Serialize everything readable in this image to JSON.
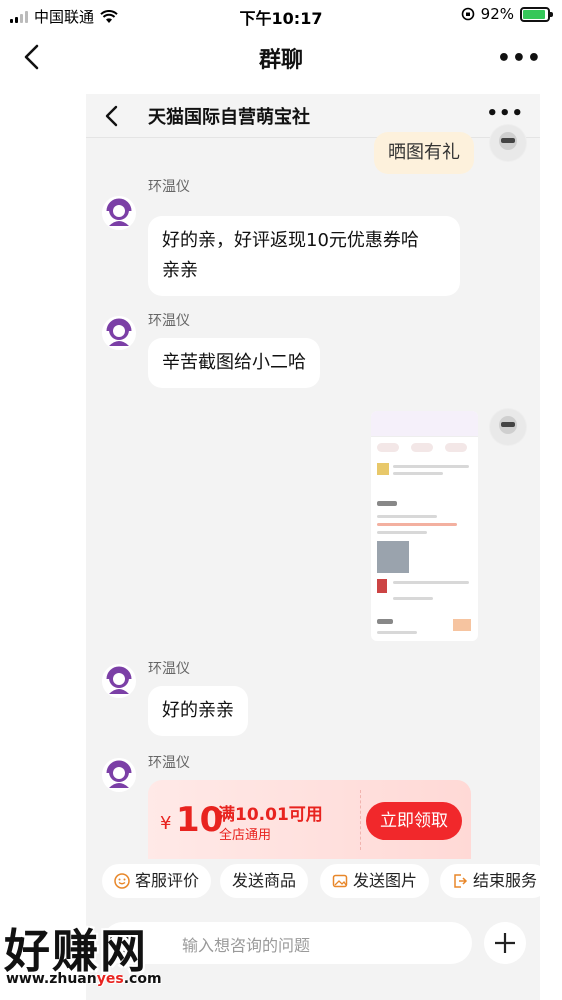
{
  "status_bar": {
    "carrier": "中国联通",
    "time": "下午10:17",
    "battery": "92%",
    "battery_level": 0.92
  },
  "outer_nav": {
    "title": "群聊",
    "more": "•••"
  },
  "inner_header": {
    "shop_name": "天猫国际自营萌宝社",
    "more": "•••"
  },
  "messages": [
    {
      "side": "right",
      "type": "text",
      "text": "晒图有礼"
    },
    {
      "side": "left",
      "type": "text",
      "sender": "环温仪",
      "lines": [
        "好的亲，好评返现10元优惠券哈",
        "亲亲"
      ]
    },
    {
      "side": "left",
      "type": "text",
      "sender": "环温仪",
      "text": "辛苦截图给小二哈"
    },
    {
      "side": "right",
      "type": "image"
    },
    {
      "side": "left",
      "type": "text",
      "sender": "环温仪",
      "text": "好的亲亲"
    },
    {
      "side": "left",
      "type": "coupon",
      "sender": "环温仪"
    }
  ],
  "coupon": {
    "currency": "¥",
    "amount": "10",
    "condition": "满10.01可用",
    "scope": "全店通用",
    "claim_label": "立即领取"
  },
  "quick_actions": [
    {
      "label": "客服评价",
      "icon": "smile-icon"
    },
    {
      "label": "发送商品",
      "icon": ""
    },
    {
      "label": "发送图片",
      "icon": "image-icon"
    },
    {
      "label": "结束服务",
      "icon": "exit-icon"
    }
  ],
  "input": {
    "placeholder": "输入想咨询的问题"
  },
  "watermark": {
    "text": "好赚网",
    "url_prefix": "www.zhuan",
    "url_highlight": "yes",
    "url_suffix": ".com"
  },
  "colors": {
    "accent": "#f1282b",
    "coupon_text": "#e8231f",
    "bubble_highlight": "#fdf1dc",
    "staff_avatar": "#7b3fa6",
    "battery_fill": "#35c759"
  }
}
